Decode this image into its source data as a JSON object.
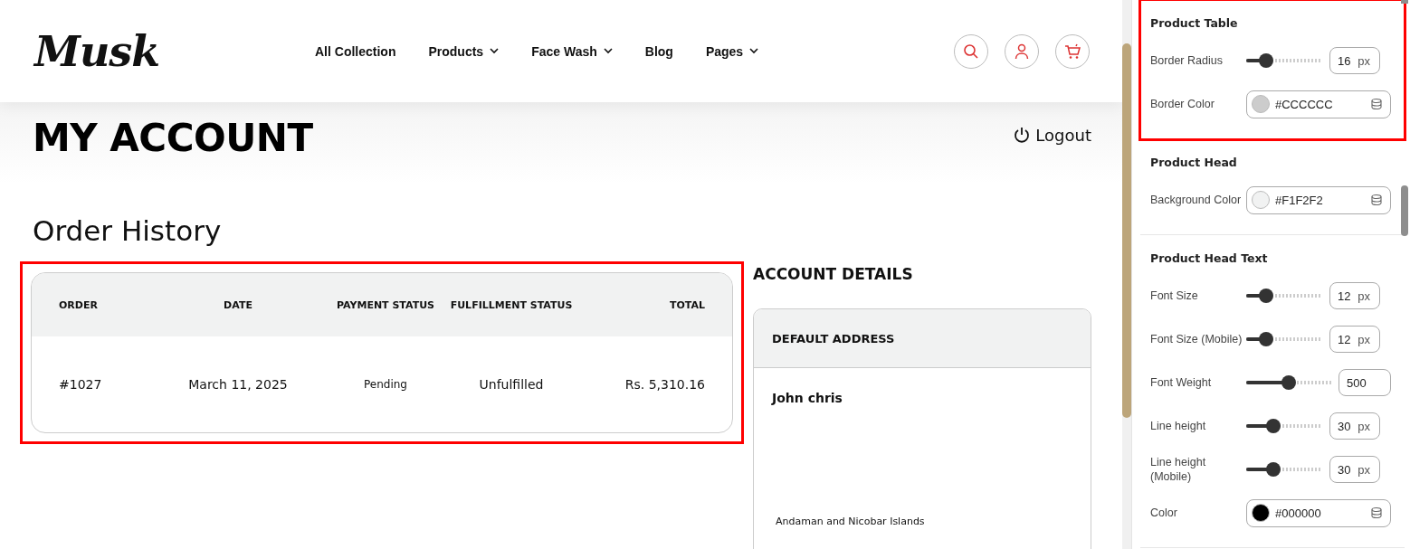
{
  "header": {
    "logo": "Musk",
    "nav": [
      {
        "label": "All Collection",
        "has_menu": false
      },
      {
        "label": "Products",
        "has_menu": true
      },
      {
        "label": "Face Wash",
        "has_menu": true
      },
      {
        "label": "Blog",
        "has_menu": false
      },
      {
        "label": "Pages",
        "has_menu": true
      }
    ]
  },
  "page": {
    "title": "MY ACCOUNT",
    "logout": "Logout",
    "order_history": {
      "heading": "Order History",
      "highlighted": true,
      "columns": [
        "ORDER",
        "DATE",
        "PAYMENT STATUS",
        "FULFILLMENT STATUS",
        "TOTAL"
      ],
      "rows": [
        [
          "#1027",
          "March 11, 2025",
          "Pending",
          "Unfulfilled",
          "Rs. 5,310.16"
        ]
      ]
    },
    "account_details": {
      "heading": "ACCOUNT DETAILS",
      "card_title": "DEFAULT ADDRESS",
      "name": "John chris",
      "address_line": "Andaman and Nicobar Islands"
    }
  },
  "settings": {
    "sections": [
      {
        "title": "Product Table",
        "highlighted": true,
        "rows": [
          {
            "kind": "slider",
            "label": "Border Radius",
            "level": 0.2,
            "value": "16",
            "unit": "px"
          },
          {
            "kind": "color",
            "label": "Border Color",
            "color": "#cccccc",
            "value": "#CCCCCC"
          }
        ]
      },
      {
        "title": "Product Head",
        "highlighted": false,
        "rows": [
          {
            "kind": "color",
            "label": "Background Color",
            "color": "#f1f2f2",
            "value": "#F1F2F2"
          }
        ]
      },
      {
        "title": "Product Head Text",
        "highlighted": false,
        "rows": [
          {
            "kind": "slider",
            "label": "Font Size",
            "level": 0.2,
            "value": "12",
            "unit": "px"
          },
          {
            "kind": "slider",
            "label": "Font Size (Mobile)",
            "level": 0.2,
            "value": "12",
            "unit": "px"
          },
          {
            "kind": "slider",
            "label": "Font Weight",
            "level": 0.5,
            "value": "500"
          },
          {
            "kind": "slider",
            "label": "Line height",
            "level": 0.33,
            "value": "30",
            "unit": "px"
          },
          {
            "kind": "slider",
            "label": "Line height (Mobile)",
            "level": 0.33,
            "value": "30",
            "unit": "px"
          },
          {
            "kind": "color",
            "label": "Color",
            "color": "#000000",
            "value": "#000000"
          }
        ]
      }
    ]
  }
}
